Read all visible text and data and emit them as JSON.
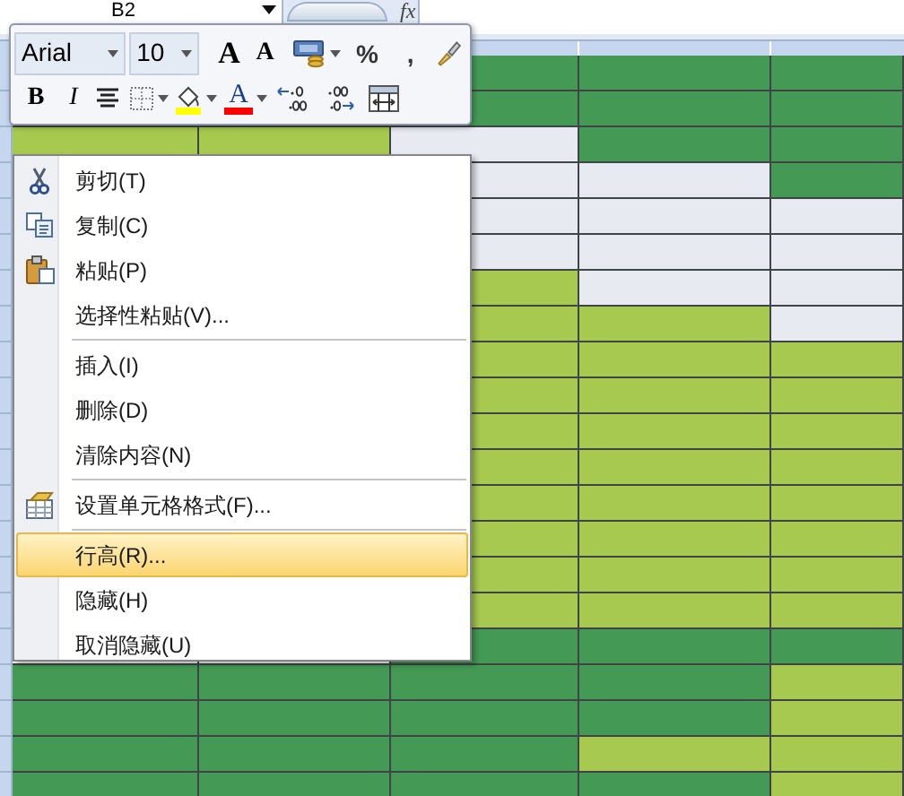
{
  "name_box": {
    "value": "B2"
  },
  "formula_bar": {
    "fx": "fx"
  },
  "mini_toolbar": {
    "row_1": [
      {
        "kind": "font",
        "value": "Arial"
      },
      {
        "kind": "size",
        "value": "10"
      },
      {
        "kind": "grow",
        "glyph": "A"
      },
      {
        "kind": "shrink",
        "glyph": "A"
      },
      {
        "kind": "accounting"
      },
      {
        "kind": "percent",
        "glyph": "%"
      },
      {
        "kind": "comma",
        "glyph": ","
      },
      {
        "kind": "painter"
      }
    ],
    "row_2": [
      {
        "kind": "bold",
        "glyph": "B"
      },
      {
        "kind": "italic",
        "glyph": "I"
      },
      {
        "kind": "center"
      },
      {
        "kind": "borders"
      },
      {
        "kind": "fill",
        "color": "#ffff00"
      },
      {
        "kind": "font_color",
        "glyph": "A",
        "color": "#ff0000"
      },
      {
        "kind": "inc_decimal"
      },
      {
        "kind": "dec_decimal"
      },
      {
        "kind": "merge"
      }
    ]
  },
  "sheet": {
    "rows": [
      {
        "cells": [
          null,
          null,
          {
            "color": "#449a55"
          },
          {
            "color": "#449a55"
          },
          {
            "color": "#449a55"
          }
        ]
      },
      {
        "cells": [
          null,
          null,
          {
            "color": "#449a55"
          },
          {
            "color": "#449a55"
          },
          {
            "color": "#449a55"
          }
        ]
      },
      {
        "cells": [
          {
            "color": "#a8c94f"
          },
          {
            "color": "#a8c94f"
          },
          {
            "color": "#e8eaf1"
          },
          {
            "color": "#449a55"
          },
          {
            "color": "#449a55"
          }
        ]
      },
      {
        "cells": [
          null,
          null,
          {
            "color": "#e8eaf1"
          },
          {
            "color": "#e8eaf1"
          },
          {
            "color": "#449a55"
          }
        ]
      },
      {
        "cells": [
          null,
          null,
          {
            "color": "#e8eaf1"
          },
          {
            "color": "#e8eaf1"
          },
          {
            "color": "#e8eaf1"
          }
        ]
      },
      {
        "cells": [
          null,
          null,
          {
            "color": "#e8eaf1"
          },
          {
            "color": "#e8eaf1"
          },
          {
            "color": "#e8eaf1"
          }
        ]
      },
      {
        "cells": [
          null,
          null,
          {
            "color": "#a8c94f"
          },
          {
            "color": "#e8eaf1"
          },
          {
            "color": "#e8eaf1"
          }
        ]
      },
      {
        "cells": [
          null,
          null,
          {
            "color": "#a8c94f"
          },
          {
            "color": "#a8c94f"
          },
          {
            "color": "#e8eaf1"
          }
        ]
      },
      {
        "cells": [
          null,
          null,
          {
            "color": "#a8c94f"
          },
          {
            "color": "#a8c94f"
          },
          {
            "color": "#a8c94f"
          }
        ]
      },
      {
        "cells": [
          null,
          null,
          {
            "color": "#a8c94f"
          },
          {
            "color": "#a8c94f"
          },
          {
            "color": "#a8c94f"
          }
        ]
      },
      {
        "cells": [
          null,
          null,
          {
            "color": "#a8c94f"
          },
          {
            "color": "#a8c94f"
          },
          {
            "color": "#a8c94f"
          }
        ]
      },
      {
        "cells": [
          null,
          null,
          {
            "color": "#a8c94f"
          },
          {
            "color": "#a8c94f"
          },
          {
            "color": "#a8c94f"
          }
        ]
      },
      {
        "cells": [
          null,
          null,
          {
            "color": "#a8c94f"
          },
          {
            "color": "#a8c94f"
          },
          {
            "color": "#a8c94f"
          }
        ]
      },
      {
        "cells": [
          null,
          null,
          {
            "color": "#a8c94f"
          },
          {
            "color": "#a8c94f"
          },
          {
            "color": "#a8c94f"
          }
        ]
      },
      {
        "cells": [
          null,
          null,
          {
            "color": "#a8c94f"
          },
          {
            "color": "#a8c94f"
          },
          {
            "color": "#a8c94f"
          }
        ]
      },
      {
        "cells": [
          null,
          null,
          {
            "color": "#a8c94f"
          },
          {
            "color": "#a8c94f"
          },
          {
            "color": "#a8c94f"
          }
        ]
      },
      {
        "cells": [
          null,
          null,
          {
            "color": "#449a55"
          },
          {
            "color": "#449a55"
          },
          {
            "color": "#449a55"
          }
        ]
      },
      {
        "cells": [
          {
            "color": "#449a55"
          },
          {
            "color": "#449a55"
          },
          {
            "color": "#449a55"
          },
          {
            "color": "#449a55"
          },
          {
            "color": "#a8c94f"
          }
        ]
      },
      {
        "cells": [
          {
            "color": "#449a55"
          },
          {
            "color": "#449a55"
          },
          {
            "color": "#449a55"
          },
          {
            "color": "#449a55"
          },
          {
            "color": "#a8c94f"
          }
        ]
      },
      {
        "cells": [
          {
            "color": "#449a55"
          },
          {
            "color": "#449a55"
          },
          {
            "color": "#449a55"
          },
          {
            "color": "#a8c94f"
          },
          {
            "color": "#a8c94f"
          }
        ]
      },
      {
        "cells": [
          {
            "color": "#449a55"
          },
          {
            "color": "#449a55"
          },
          {
            "color": "#449a55"
          },
          {
            "color": "#449a55"
          },
          {
            "color": "#a8c94f"
          }
        ]
      }
    ]
  },
  "context_menu": {
    "items": [
      {
        "kind": "item",
        "label": "剪切(T)",
        "selected": false
      },
      {
        "kind": "item",
        "label": "复制(C)",
        "selected": false
      },
      {
        "kind": "item",
        "label": "粘贴(P)",
        "selected": false
      },
      {
        "kind": "item",
        "label": "选择性粘贴(V)...",
        "selected": false
      },
      {
        "kind": "separator"
      },
      {
        "kind": "item",
        "label": "插入(I)",
        "selected": false
      },
      {
        "kind": "item",
        "label": "删除(D)",
        "selected": false
      },
      {
        "kind": "item",
        "label": "清除内容(N)",
        "selected": false
      },
      {
        "kind": "separator"
      },
      {
        "kind": "item",
        "label": "设置单元格格式(F)...",
        "selected": false
      },
      {
        "kind": "separator"
      },
      {
        "kind": "item",
        "label": "行高(R)...",
        "selected": true
      },
      {
        "kind": "item",
        "label": "隐藏(H)",
        "selected": false
      },
      {
        "kind": "item",
        "label": "取消隐藏(U)",
        "selected": false
      }
    ]
  }
}
